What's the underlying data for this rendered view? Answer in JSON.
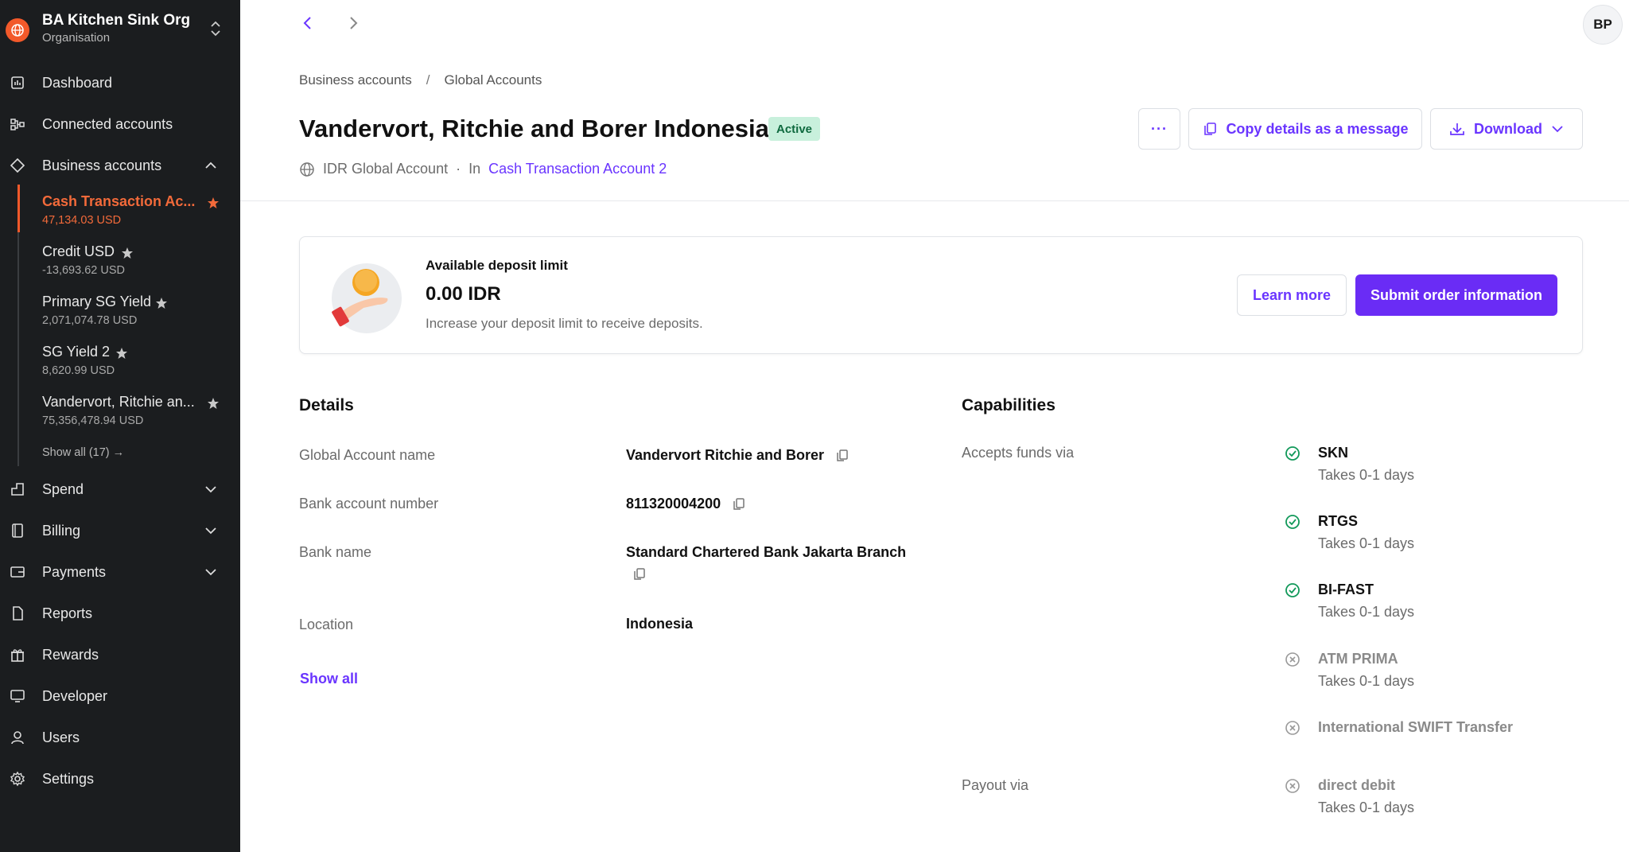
{
  "org": {
    "name": "BA Kitchen Sink Org",
    "subtitle": "Organisation"
  },
  "nav": {
    "dashboard": "Dashboard",
    "connected": "Connected accounts",
    "business": "Business accounts",
    "spend": "Spend",
    "billing": "Billing",
    "payments": "Payments",
    "reports": "Reports",
    "rewards": "Rewards",
    "developer": "Developer",
    "users": "Users",
    "settings": "Settings"
  },
  "business_accounts": [
    {
      "name": "Cash Transaction Ac...",
      "value": "47,134.03 USD",
      "starred": true
    },
    {
      "name": "Credit USD",
      "value": "-13,693.62 USD",
      "starred": true
    },
    {
      "name": "Primary SG Yield",
      "value": "2,071,074.78 USD",
      "starred": true
    },
    {
      "name": "SG Yield 2",
      "value": "8,620.99 USD",
      "starred": true
    },
    {
      "name": "Vandervort, Ritchie an...",
      "value": "75,356,478.94 USD",
      "starred": true
    }
  ],
  "sidebar_show_all": "Show all (17) →",
  "user": {
    "initials": "BP"
  },
  "breadcrumb": {
    "parent": "Business accounts",
    "sep": "/",
    "current": "Global Accounts"
  },
  "page": {
    "title": "Vandervort, Ritchie and Borer Indonesia",
    "status": "Active",
    "account_type": "IDR Global Account",
    "dot": "·",
    "in_label": "In",
    "parent_account": "Cash Transaction Account 2"
  },
  "actions": {
    "more": "···",
    "copy": "Copy details as a message",
    "download": "Download"
  },
  "deposit": {
    "label": "Available deposit limit",
    "amount": "0.00 IDR",
    "description": "Increase your deposit limit to receive deposits.",
    "learn_more": "Learn more",
    "submit": "Submit order information"
  },
  "details": {
    "title": "Details",
    "rows": [
      {
        "label": "Global Account name",
        "value": "Vandervort Ritchie and Borer"
      },
      {
        "label": "Bank account number",
        "value": "811320004200"
      },
      {
        "label": "Bank name",
        "value": "Standard Chartered Bank Jakarta Branch"
      },
      {
        "label": "Location",
        "value": "Indonesia"
      }
    ],
    "show_all": "Show all"
  },
  "capabilities": {
    "title": "Capabilities",
    "accepts_label": "Accepts funds via",
    "payout_label": "Payout via",
    "accepts": [
      {
        "name": "SKN",
        "desc": "Takes 0-1 days",
        "enabled": true
      },
      {
        "name": "RTGS",
        "desc": "Takes 0-1 days",
        "enabled": true
      },
      {
        "name": "BI-FAST",
        "desc": "Takes 0-1 days",
        "enabled": true
      },
      {
        "name": "ATM PRIMA",
        "desc": "Takes 0-1 days",
        "enabled": false
      },
      {
        "name": "International SWIFT Transfer",
        "desc": "",
        "enabled": false
      }
    ],
    "payout": [
      {
        "name": "direct debit",
        "desc": "Takes 0-1 days",
        "enabled": false
      }
    ]
  },
  "colors": {
    "accent": "#6a35ff",
    "brand_orange": "#f2592a",
    "sidebar_bg": "#1b1d1f",
    "success": "#12995a"
  }
}
